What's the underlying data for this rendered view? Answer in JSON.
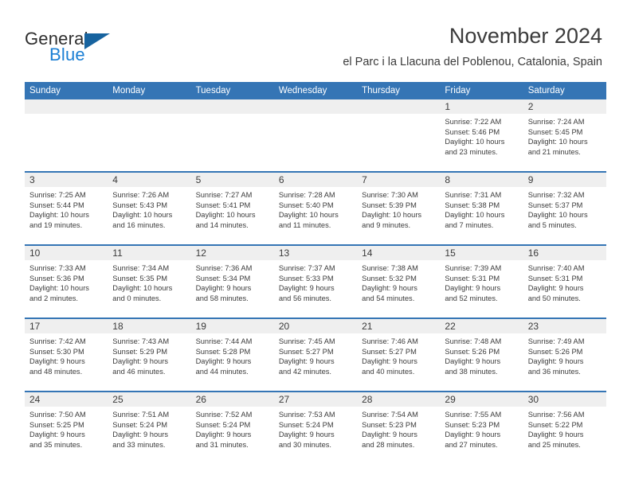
{
  "logo": {
    "word_one": "General",
    "word_two": "Blue",
    "mark": "triangle-mark"
  },
  "header": {
    "title": "November 2024",
    "subtitle": "el Parc i la Llacuna del Poblenou, Catalonia, Spain"
  },
  "colors": {
    "header_blue": "#3575b5",
    "logo_blue": "#1b7fd4",
    "logo_mark_blue": "#17639f",
    "day_band_gray": "#efefef",
    "text": "#3b3b3b"
  },
  "weekdays": [
    "Sunday",
    "Monday",
    "Tuesday",
    "Wednesday",
    "Thursday",
    "Friday",
    "Saturday"
  ],
  "labels": {
    "sunrise_prefix": "Sunrise:",
    "sunset_prefix": "Sunset:",
    "daylight_prefix": "Daylight:"
  },
  "weeks": [
    [
      {
        "day": "",
        "sunrise": "",
        "sunset": "",
        "daylight_line1": "",
        "daylight_line2": "",
        "empty": true
      },
      {
        "day": "",
        "sunrise": "",
        "sunset": "",
        "daylight_line1": "",
        "daylight_line2": "",
        "empty": true
      },
      {
        "day": "",
        "sunrise": "",
        "sunset": "",
        "daylight_line1": "",
        "daylight_line2": "",
        "empty": true
      },
      {
        "day": "",
        "sunrise": "",
        "sunset": "",
        "daylight_line1": "",
        "daylight_line2": "",
        "empty": true
      },
      {
        "day": "",
        "sunrise": "",
        "sunset": "",
        "daylight_line1": "",
        "daylight_line2": "",
        "empty": true
      },
      {
        "day": "1",
        "sunrise": "Sunrise: 7:22 AM",
        "sunset": "Sunset: 5:46 PM",
        "daylight_line1": "Daylight: 10 hours",
        "daylight_line2": "and 23 minutes.",
        "empty": false
      },
      {
        "day": "2",
        "sunrise": "Sunrise: 7:24 AM",
        "sunset": "Sunset: 5:45 PM",
        "daylight_line1": "Daylight: 10 hours",
        "daylight_line2": "and 21 minutes.",
        "empty": false
      }
    ],
    [
      {
        "day": "3",
        "sunrise": "Sunrise: 7:25 AM",
        "sunset": "Sunset: 5:44 PM",
        "daylight_line1": "Daylight: 10 hours",
        "daylight_line2": "and 19 minutes.",
        "empty": false
      },
      {
        "day": "4",
        "sunrise": "Sunrise: 7:26 AM",
        "sunset": "Sunset: 5:43 PM",
        "daylight_line1": "Daylight: 10 hours",
        "daylight_line2": "and 16 minutes.",
        "empty": false
      },
      {
        "day": "5",
        "sunrise": "Sunrise: 7:27 AM",
        "sunset": "Sunset: 5:41 PM",
        "daylight_line1": "Daylight: 10 hours",
        "daylight_line2": "and 14 minutes.",
        "empty": false
      },
      {
        "day": "6",
        "sunrise": "Sunrise: 7:28 AM",
        "sunset": "Sunset: 5:40 PM",
        "daylight_line1": "Daylight: 10 hours",
        "daylight_line2": "and 11 minutes.",
        "empty": false
      },
      {
        "day": "7",
        "sunrise": "Sunrise: 7:30 AM",
        "sunset": "Sunset: 5:39 PM",
        "daylight_line1": "Daylight: 10 hours",
        "daylight_line2": "and 9 minutes.",
        "empty": false
      },
      {
        "day": "8",
        "sunrise": "Sunrise: 7:31 AM",
        "sunset": "Sunset: 5:38 PM",
        "daylight_line1": "Daylight: 10 hours",
        "daylight_line2": "and 7 minutes.",
        "empty": false
      },
      {
        "day": "9",
        "sunrise": "Sunrise: 7:32 AM",
        "sunset": "Sunset: 5:37 PM",
        "daylight_line1": "Daylight: 10 hours",
        "daylight_line2": "and 5 minutes.",
        "empty": false
      }
    ],
    [
      {
        "day": "10",
        "sunrise": "Sunrise: 7:33 AM",
        "sunset": "Sunset: 5:36 PM",
        "daylight_line1": "Daylight: 10 hours",
        "daylight_line2": "and 2 minutes.",
        "empty": false
      },
      {
        "day": "11",
        "sunrise": "Sunrise: 7:34 AM",
        "sunset": "Sunset: 5:35 PM",
        "daylight_line1": "Daylight: 10 hours",
        "daylight_line2": "and 0 minutes.",
        "empty": false
      },
      {
        "day": "12",
        "sunrise": "Sunrise: 7:36 AM",
        "sunset": "Sunset: 5:34 PM",
        "daylight_line1": "Daylight: 9 hours",
        "daylight_line2": "and 58 minutes.",
        "empty": false
      },
      {
        "day": "13",
        "sunrise": "Sunrise: 7:37 AM",
        "sunset": "Sunset: 5:33 PM",
        "daylight_line1": "Daylight: 9 hours",
        "daylight_line2": "and 56 minutes.",
        "empty": false
      },
      {
        "day": "14",
        "sunrise": "Sunrise: 7:38 AM",
        "sunset": "Sunset: 5:32 PM",
        "daylight_line1": "Daylight: 9 hours",
        "daylight_line2": "and 54 minutes.",
        "empty": false
      },
      {
        "day": "15",
        "sunrise": "Sunrise: 7:39 AM",
        "sunset": "Sunset: 5:31 PM",
        "daylight_line1": "Daylight: 9 hours",
        "daylight_line2": "and 52 minutes.",
        "empty": false
      },
      {
        "day": "16",
        "sunrise": "Sunrise: 7:40 AM",
        "sunset": "Sunset: 5:31 PM",
        "daylight_line1": "Daylight: 9 hours",
        "daylight_line2": "and 50 minutes.",
        "empty": false
      }
    ],
    [
      {
        "day": "17",
        "sunrise": "Sunrise: 7:42 AM",
        "sunset": "Sunset: 5:30 PM",
        "daylight_line1": "Daylight: 9 hours",
        "daylight_line2": "and 48 minutes.",
        "empty": false
      },
      {
        "day": "18",
        "sunrise": "Sunrise: 7:43 AM",
        "sunset": "Sunset: 5:29 PM",
        "daylight_line1": "Daylight: 9 hours",
        "daylight_line2": "and 46 minutes.",
        "empty": false
      },
      {
        "day": "19",
        "sunrise": "Sunrise: 7:44 AM",
        "sunset": "Sunset: 5:28 PM",
        "daylight_line1": "Daylight: 9 hours",
        "daylight_line2": "and 44 minutes.",
        "empty": false
      },
      {
        "day": "20",
        "sunrise": "Sunrise: 7:45 AM",
        "sunset": "Sunset: 5:27 PM",
        "daylight_line1": "Daylight: 9 hours",
        "daylight_line2": "and 42 minutes.",
        "empty": false
      },
      {
        "day": "21",
        "sunrise": "Sunrise: 7:46 AM",
        "sunset": "Sunset: 5:27 PM",
        "daylight_line1": "Daylight: 9 hours",
        "daylight_line2": "and 40 minutes.",
        "empty": false
      },
      {
        "day": "22",
        "sunrise": "Sunrise: 7:48 AM",
        "sunset": "Sunset: 5:26 PM",
        "daylight_line1": "Daylight: 9 hours",
        "daylight_line2": "and 38 minutes.",
        "empty": false
      },
      {
        "day": "23",
        "sunrise": "Sunrise: 7:49 AM",
        "sunset": "Sunset: 5:26 PM",
        "daylight_line1": "Daylight: 9 hours",
        "daylight_line2": "and 36 minutes.",
        "empty": false
      }
    ],
    [
      {
        "day": "24",
        "sunrise": "Sunrise: 7:50 AM",
        "sunset": "Sunset: 5:25 PM",
        "daylight_line1": "Daylight: 9 hours",
        "daylight_line2": "and 35 minutes.",
        "empty": false
      },
      {
        "day": "25",
        "sunrise": "Sunrise: 7:51 AM",
        "sunset": "Sunset: 5:24 PM",
        "daylight_line1": "Daylight: 9 hours",
        "daylight_line2": "and 33 minutes.",
        "empty": false
      },
      {
        "day": "26",
        "sunrise": "Sunrise: 7:52 AM",
        "sunset": "Sunset: 5:24 PM",
        "daylight_line1": "Daylight: 9 hours",
        "daylight_line2": "and 31 minutes.",
        "empty": false
      },
      {
        "day": "27",
        "sunrise": "Sunrise: 7:53 AM",
        "sunset": "Sunset: 5:24 PM",
        "daylight_line1": "Daylight: 9 hours",
        "daylight_line2": "and 30 minutes.",
        "empty": false
      },
      {
        "day": "28",
        "sunrise": "Sunrise: 7:54 AM",
        "sunset": "Sunset: 5:23 PM",
        "daylight_line1": "Daylight: 9 hours",
        "daylight_line2": "and 28 minutes.",
        "empty": false
      },
      {
        "day": "29",
        "sunrise": "Sunrise: 7:55 AM",
        "sunset": "Sunset: 5:23 PM",
        "daylight_line1": "Daylight: 9 hours",
        "daylight_line2": "and 27 minutes.",
        "empty": false
      },
      {
        "day": "30",
        "sunrise": "Sunrise: 7:56 AM",
        "sunset": "Sunset: 5:22 PM",
        "daylight_line1": "Daylight: 9 hours",
        "daylight_line2": "and 25 minutes.",
        "empty": false
      }
    ]
  ]
}
